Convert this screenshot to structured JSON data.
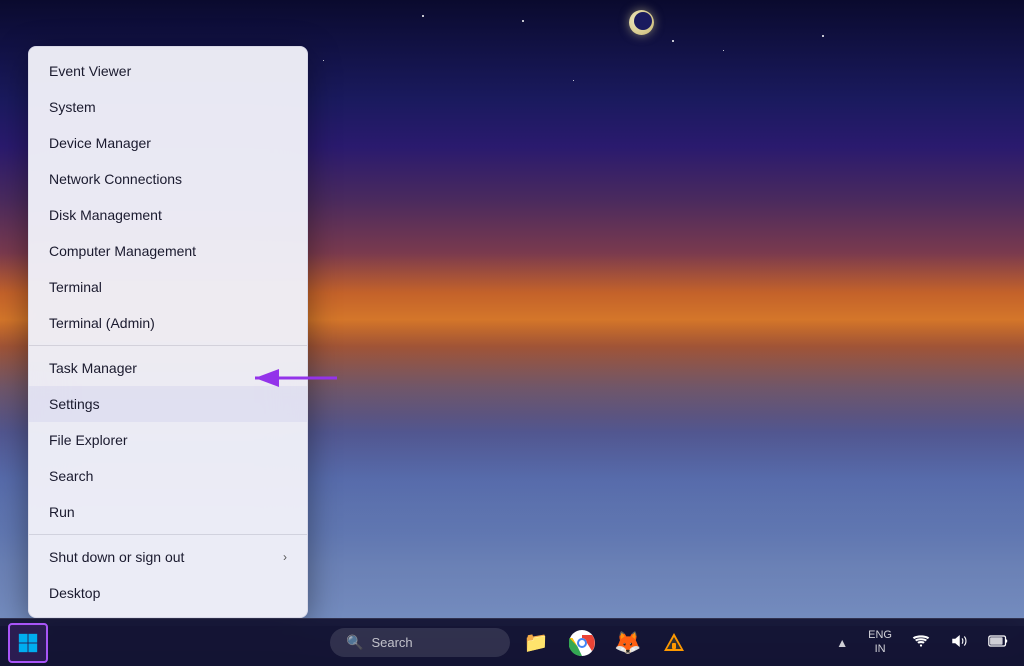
{
  "desktop": {
    "background": "night sky with moon over snowy landscape at dusk"
  },
  "contextMenu": {
    "items": [
      {
        "id": "event-viewer",
        "label": "Event Viewer",
        "hasArrow": false,
        "hasDivider": false
      },
      {
        "id": "system",
        "label": "System",
        "hasArrow": false,
        "hasDivider": false
      },
      {
        "id": "device-manager",
        "label": "Device Manager",
        "hasArrow": false,
        "hasDivider": false
      },
      {
        "id": "network-connections",
        "label": "Network Connections",
        "hasArrow": false,
        "hasDivider": false
      },
      {
        "id": "disk-management",
        "label": "Disk Management",
        "hasArrow": false,
        "hasDivider": false
      },
      {
        "id": "computer-management",
        "label": "Computer Management",
        "hasArrow": false,
        "hasDivider": false
      },
      {
        "id": "terminal",
        "label": "Terminal",
        "hasArrow": false,
        "hasDivider": false
      },
      {
        "id": "terminal-admin",
        "label": "Terminal (Admin)",
        "hasArrow": false,
        "hasDivider": true
      },
      {
        "id": "task-manager",
        "label": "Task Manager",
        "hasArrow": false,
        "hasDivider": false
      },
      {
        "id": "settings",
        "label": "Settings",
        "hasArrow": false,
        "hasDivider": false,
        "highlighted": true
      },
      {
        "id": "file-explorer",
        "label": "File Explorer",
        "hasArrow": false,
        "hasDivider": false
      },
      {
        "id": "search",
        "label": "Search",
        "hasArrow": false,
        "hasDivider": false
      },
      {
        "id": "run",
        "label": "Run",
        "hasArrow": false,
        "hasDivider": true
      },
      {
        "id": "shut-down",
        "label": "Shut down or sign out",
        "hasArrow": true,
        "hasDivider": false
      },
      {
        "id": "desktop",
        "label": "Desktop",
        "hasArrow": false,
        "hasDivider": false
      }
    ]
  },
  "taskbar": {
    "searchPlaceholder": "Search",
    "startButton": "Windows Start",
    "tray": {
      "chevron": "▲",
      "language": "ENG\nIN",
      "wifi": "wifi",
      "volume": "volume",
      "battery": "battery"
    },
    "apps": [
      {
        "id": "file-explorer",
        "icon": "📁"
      },
      {
        "id": "chrome",
        "icon": ""
      },
      {
        "id": "firefox",
        "icon": "🦊"
      },
      {
        "id": "vlc",
        "icon": "🎬"
      }
    ]
  }
}
